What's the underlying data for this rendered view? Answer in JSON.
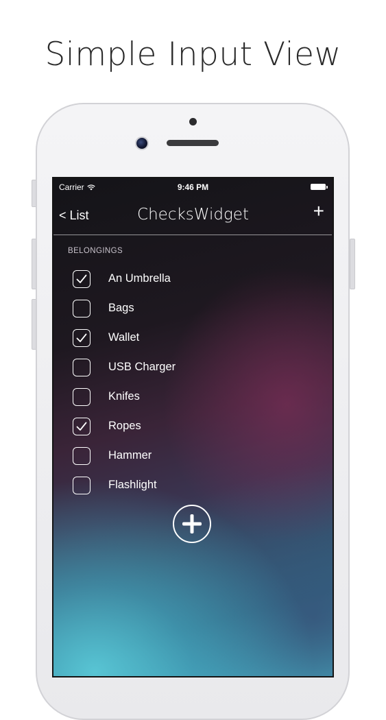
{
  "caption": "Simple Input View",
  "status_bar": {
    "carrier": "Carrier",
    "time": "9:46 PM",
    "wifi_icon": "wifi-icon",
    "battery_icon": "battery-icon"
  },
  "nav": {
    "back_label": "< List",
    "title": "ChecksWidget",
    "add_label": "+"
  },
  "section": {
    "header": "BELONGINGS"
  },
  "items": [
    {
      "label": "An Umbrella",
      "checked": true
    },
    {
      "label": "Bags",
      "checked": false
    },
    {
      "label": "Wallet",
      "checked": true
    },
    {
      "label": "USB Charger",
      "checked": false
    },
    {
      "label": "Knifes",
      "checked": false
    },
    {
      "label": "Ropes",
      "checked": true
    },
    {
      "label": "Hammer",
      "checked": false
    },
    {
      "label": "Flashlight",
      "checked": false
    }
  ],
  "add_button_icon": "plus-circle-icon",
  "colors": {
    "accent": "#ffffff",
    "background_top": "#141418",
    "background_mid": "#3a2438",
    "background_bottom": "#4ab9cc"
  }
}
